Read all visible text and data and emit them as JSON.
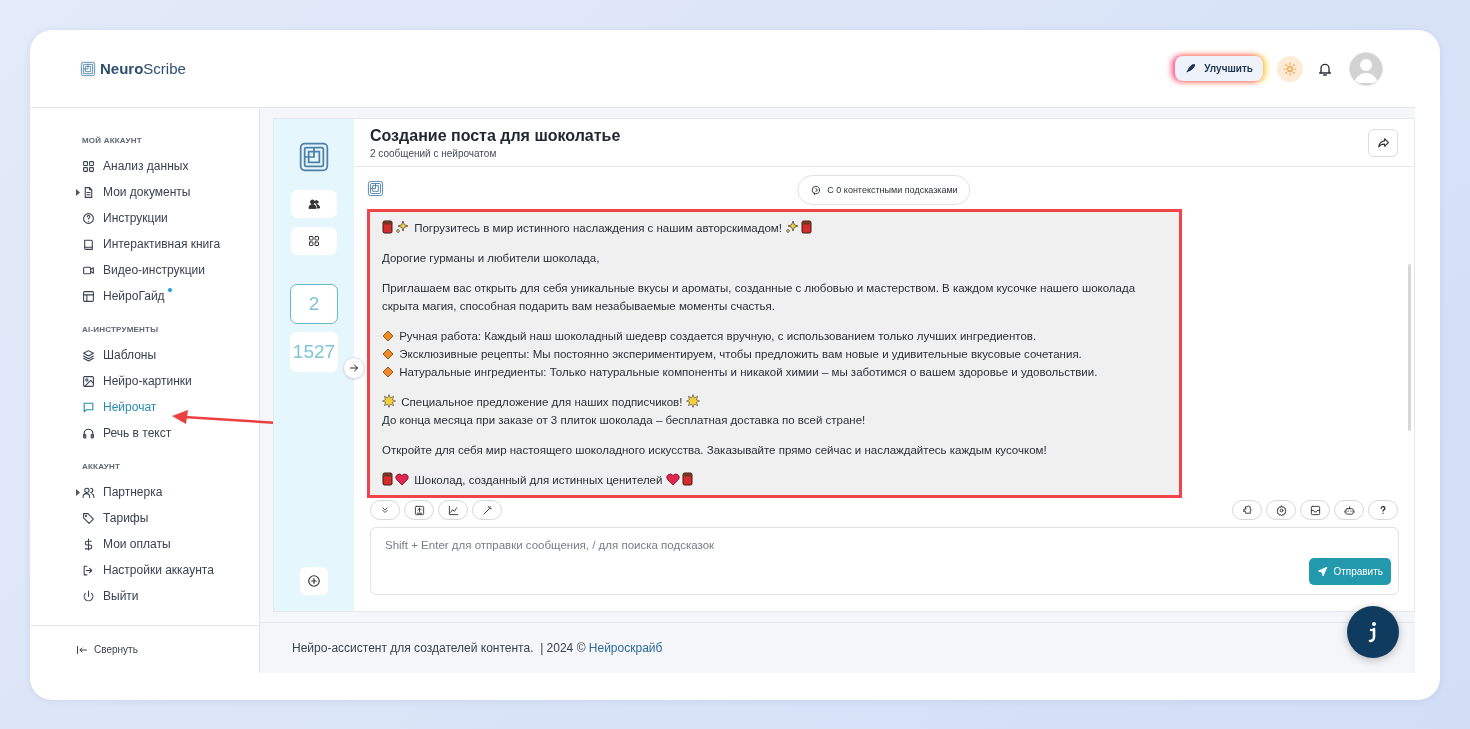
{
  "brand": {
    "bold": "Neuro",
    "light": "Scribe"
  },
  "header": {
    "upgrade_button": "Улучшить"
  },
  "sidebar": {
    "sections": [
      {
        "title": "МОЙ АККАУНТ",
        "items": [
          {
            "label": "Анализ данных",
            "selected": false,
            "expandable": false,
            "new": false
          },
          {
            "label": "Мои документы",
            "selected": false,
            "expandable": true,
            "new": false
          },
          {
            "label": "Инструкции",
            "selected": false,
            "expandable": false,
            "new": false
          },
          {
            "label": "Интерактивная книга",
            "selected": false,
            "expandable": false,
            "new": false
          },
          {
            "label": "Видео-инструкции",
            "selected": false,
            "expandable": false,
            "new": false
          },
          {
            "label": "НейроГайд",
            "selected": false,
            "expandable": false,
            "new": true
          }
        ]
      },
      {
        "title": "AI-ИНСТРУМЕНТЫ",
        "items": [
          {
            "label": "Шаблоны",
            "selected": false,
            "expandable": false,
            "new": false
          },
          {
            "label": "Нейро-картинки",
            "selected": false,
            "expandable": false,
            "new": false
          },
          {
            "label": "Нейрочат",
            "selected": true,
            "expandable": false,
            "new": false
          },
          {
            "label": "Речь в текст",
            "selected": false,
            "expandable": false,
            "new": false
          }
        ]
      },
      {
        "title": "АККАУНТ",
        "items": [
          {
            "label": "Партнерка",
            "selected": false,
            "expandable": true,
            "new": false
          },
          {
            "label": "Тарифы",
            "selected": false,
            "expandable": false,
            "new": false
          },
          {
            "label": "Мои оплаты",
            "selected": false,
            "expandable": false,
            "new": false
          },
          {
            "label": "Настройки аккаунта",
            "selected": false,
            "expandable": false,
            "new": false
          },
          {
            "label": "Выйти",
            "selected": false,
            "expandable": false,
            "new": false
          }
        ]
      }
    ],
    "collapse": "Свернуть"
  },
  "strip": {
    "counters": [
      {
        "value": "2",
        "selected": true
      },
      {
        "value": "1527",
        "selected": false
      }
    ]
  },
  "chat": {
    "title": "Создание поста для шоколатье",
    "subtitle": "2 сообщений с нейрочатом",
    "context_hint": "С 0 контекстными подсказками",
    "message": {
      "highlighted": true,
      "blocks": [
        {
          "lines": [
            {
              "kind": "sparkle",
              "text": "Погрузитесь в мир истинного наслаждения с нашим авторскимадом!"
            }
          ]
        },
        {
          "lines": [
            {
              "kind": "plain",
              "text": "Дорогие гурманы и любители шоколада,"
            }
          ]
        },
        {
          "lines": [
            {
              "kind": "plain",
              "text": "Приглашаем вас открыть для себя уникальные вкусы и ароматы, созданные с любовью и мастерством. В каждом кусочке нашего шоколада скрыта магия, способная подарить вам незабываемые моменты счастья."
            }
          ]
        },
        {
          "lines": [
            {
              "kind": "bullet",
              "text": "Ручная работа: Каждый наш шоколадный шедевр создается вручную, с использованием только лучших ингредиентов."
            },
            {
              "kind": "bullet",
              "text": "Эксклюзивные рецепты: Мы постоянно экспериментируем, чтобы предложить вам новые и удивительные вкусовые сочетания."
            },
            {
              "kind": "bullet",
              "text": "Натуральные ингредиенты: Только натуральные компоненты и никакой химии – мы заботимся о вашем здоровье и удовольствии."
            }
          ]
        },
        {
          "lines": [
            {
              "kind": "burst",
              "text": "Специальное предложение для наших подписчиков!"
            },
            {
              "kind": "plain",
              "text": "До конца месяца при заказе от 3 плиток шоколада – бесплатная доставка по всей стране!"
            }
          ]
        },
        {
          "lines": [
            {
              "kind": "plain",
              "text": "Откройте для себя мир настоящего шоколадного искусства. Заказывайте прямо сейчас и наслаждайтесь каждым кусочком!"
            }
          ]
        },
        {
          "lines": [
            {
              "kind": "heart",
              "text": "Шоколад, созданный для истинных ценителей"
            }
          ]
        }
      ]
    },
    "input": {
      "placeholder": "Shift + Enter для отправки сообщения, / для поиска подсказок"
    },
    "send_button": "Отправить"
  },
  "footer": {
    "text": "Нейро-ассистент для создателей контента.  | 2024 © ",
    "link": "Нейроскрайб"
  }
}
